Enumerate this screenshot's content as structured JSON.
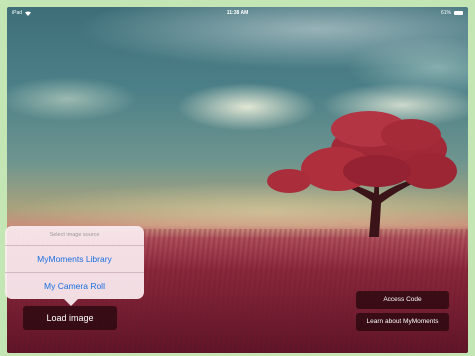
{
  "status_bar": {
    "carrier": "iPad",
    "time": "11:38 AM",
    "battery": "61%"
  },
  "image_source_menu": {
    "title": "Select image source",
    "options": [
      "MyMoments Library",
      "My Camera Roll"
    ]
  },
  "buttons": {
    "load_image": "Load image",
    "access_code": "Access Code",
    "learn_about": "Learn about MyMoments"
  },
  "background": {
    "scene": "red-tree-landscape",
    "sky_color": "#4c8088",
    "field_color": "#8a2a3c",
    "tree_color": "#a82a3a"
  },
  "popover_text_color": "#1a6fe0"
}
